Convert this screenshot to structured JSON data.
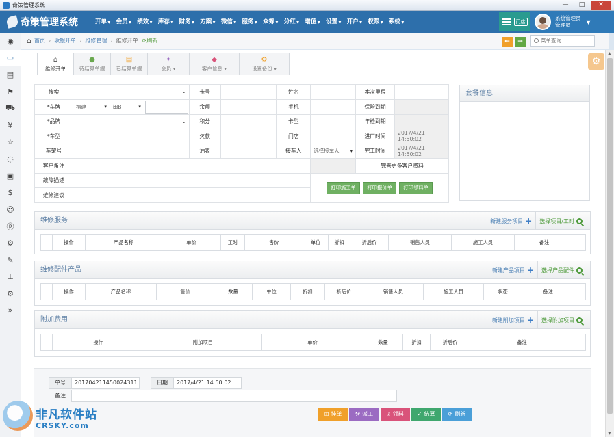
{
  "window": {
    "title": "奇策管理系统",
    "controls": [
      "—",
      "□",
      "✕"
    ]
  },
  "brand": "奇策管理系统",
  "menu": [
    "开单",
    "会员",
    "绩效",
    "库存",
    "财务",
    "方案",
    "微信",
    "服务",
    "众筹",
    "分红",
    "增值",
    "设置",
    "开户",
    "权限",
    "系统"
  ],
  "store_label": "门店",
  "user": {
    "line1": "系统管理员",
    "line2": "管理员"
  },
  "breadcrumb": {
    "items": [
      "首页",
      "收银开单",
      "维修管理"
    ],
    "current": "维修开单",
    "refresh": "刷新"
  },
  "search": {
    "placeholder": "菜单查询..."
  },
  "tabs": [
    {
      "label": "维修开单",
      "icon": "home-icon"
    },
    {
      "label": "待结算单据",
      "icon": "user-icon"
    },
    {
      "label": "已结算单据",
      "icon": "card-icon"
    },
    {
      "label": "会员",
      "icon": "wand-icon"
    },
    {
      "label": "客户信息",
      "icon": "tags-icon"
    },
    {
      "label": "设置备份",
      "icon": "gear-icon"
    }
  ],
  "form": {
    "search_label": "搜索",
    "plate_label": "车牌",
    "plate_province": "福建",
    "plate_prefix": "闽B",
    "brand_label": "品牌",
    "model_label": "车型",
    "vin_label": "车架号",
    "customer_note_label": "客户备注",
    "fault_label": "故障描述",
    "advice_label": "维修建议",
    "card_no_label": "卡号",
    "balance_label": "余额",
    "points_label": "积分",
    "debt_label": "欠款",
    "fuel_label": "油表",
    "name_label": "姓名",
    "phone_label": "手机",
    "card_type_label": "卡型",
    "store_label": "门店",
    "receiver_label": "接车人",
    "receiver_placeholder": "选择接车人",
    "next_mileage_label": "本次里程",
    "insurance_label": "保险到期",
    "inspection_label": "年检到期",
    "in_time_label": "进厂时间",
    "in_time_value": "2017/4/21 14:50:02",
    "done_time_label": "完工时间",
    "done_time_value": "2017/4/21 14:50:02",
    "more_info": "完善更多客户资料",
    "btn_print_dispatch": "打印施工单",
    "btn_print_quote": "打印报价单",
    "btn_print_material": "打印领料单"
  },
  "package": {
    "title": "套餐信息"
  },
  "service": {
    "title": "维修服务",
    "new_label": "新建服务项目",
    "choose_label": "选择项目/工时",
    "columns": [
      "操作",
      "产品名称",
      "单价",
      "工时",
      "售价",
      "单位",
      "折扣",
      "折后价",
      "销售人员",
      "施工人员",
      "备注"
    ]
  },
  "parts": {
    "title": "维修配件产品",
    "new_label": "新建产品项目",
    "choose_label": "选择产品配件",
    "columns": [
      "操作",
      "产品名称",
      "售价",
      "数量",
      "单位",
      "折扣",
      "折后价",
      "销售人员",
      "施工人员",
      "状态",
      "备注"
    ]
  },
  "extra": {
    "title": "附加费用",
    "new_label": "新建附加项目",
    "choose_label": "选择附加项目",
    "columns": [
      "操作",
      "附加项目",
      "单价",
      "数量",
      "折扣",
      "折后价",
      "备注"
    ]
  },
  "bottom": {
    "order_no_label": "单号",
    "order_no": "201704211450024311",
    "date_label": "日期",
    "date_value": "2017/4/21 14:50:02",
    "note_label": "备注",
    "buttons": [
      "挂单",
      "派工",
      "领料",
      "结算",
      "刷新"
    ]
  },
  "watermark": {
    "line1": "非凡软件站",
    "line2": "CRSKY.com"
  },
  "colors": {
    "nav": "#2d6fab",
    "green_btn": "#6fb062",
    "orange_btn": "#f0a02a",
    "purple_btn": "#9b6bc2",
    "pink_btn": "#d9537a",
    "teal_btn": "#3fa76e",
    "blue_btn": "#4a9fd8"
  }
}
